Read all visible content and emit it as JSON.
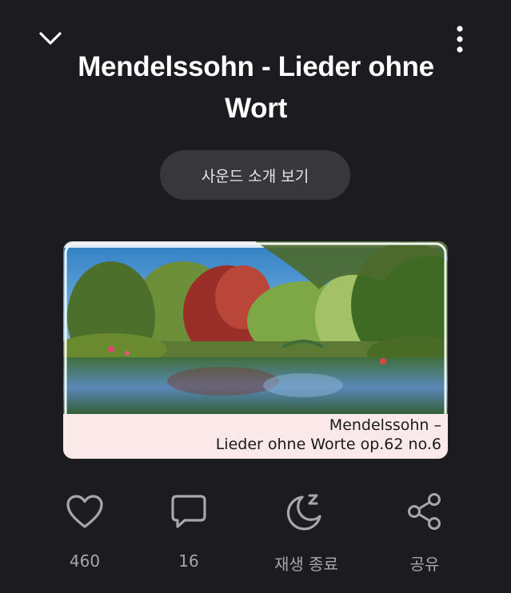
{
  "header": {
    "collapse_icon": "chevron-down-icon",
    "more_icon": "more-vertical-icon"
  },
  "track": {
    "title": "Mendelssohn - Lieder ohne Wort"
  },
  "intro_button": {
    "label": "사운드 소개 보기"
  },
  "thumbnail": {
    "caption_line1": "Mendelssohn –",
    "caption_line2": "Lieder ohne Worte op.62 no.6",
    "caption_bg": "#fbe9ea"
  },
  "actions": {
    "like": {
      "icon": "heart-icon",
      "label": "460"
    },
    "comment": {
      "icon": "comment-icon",
      "label": "16"
    },
    "sleep_timer": {
      "icon": "moon-sleep-icon",
      "label": "재생 종료"
    },
    "share": {
      "icon": "share-icon",
      "label": "공유"
    }
  },
  "colors": {
    "background": "#1c1b20",
    "pill": "#38373c",
    "muted_text": "#a7a6ab"
  }
}
